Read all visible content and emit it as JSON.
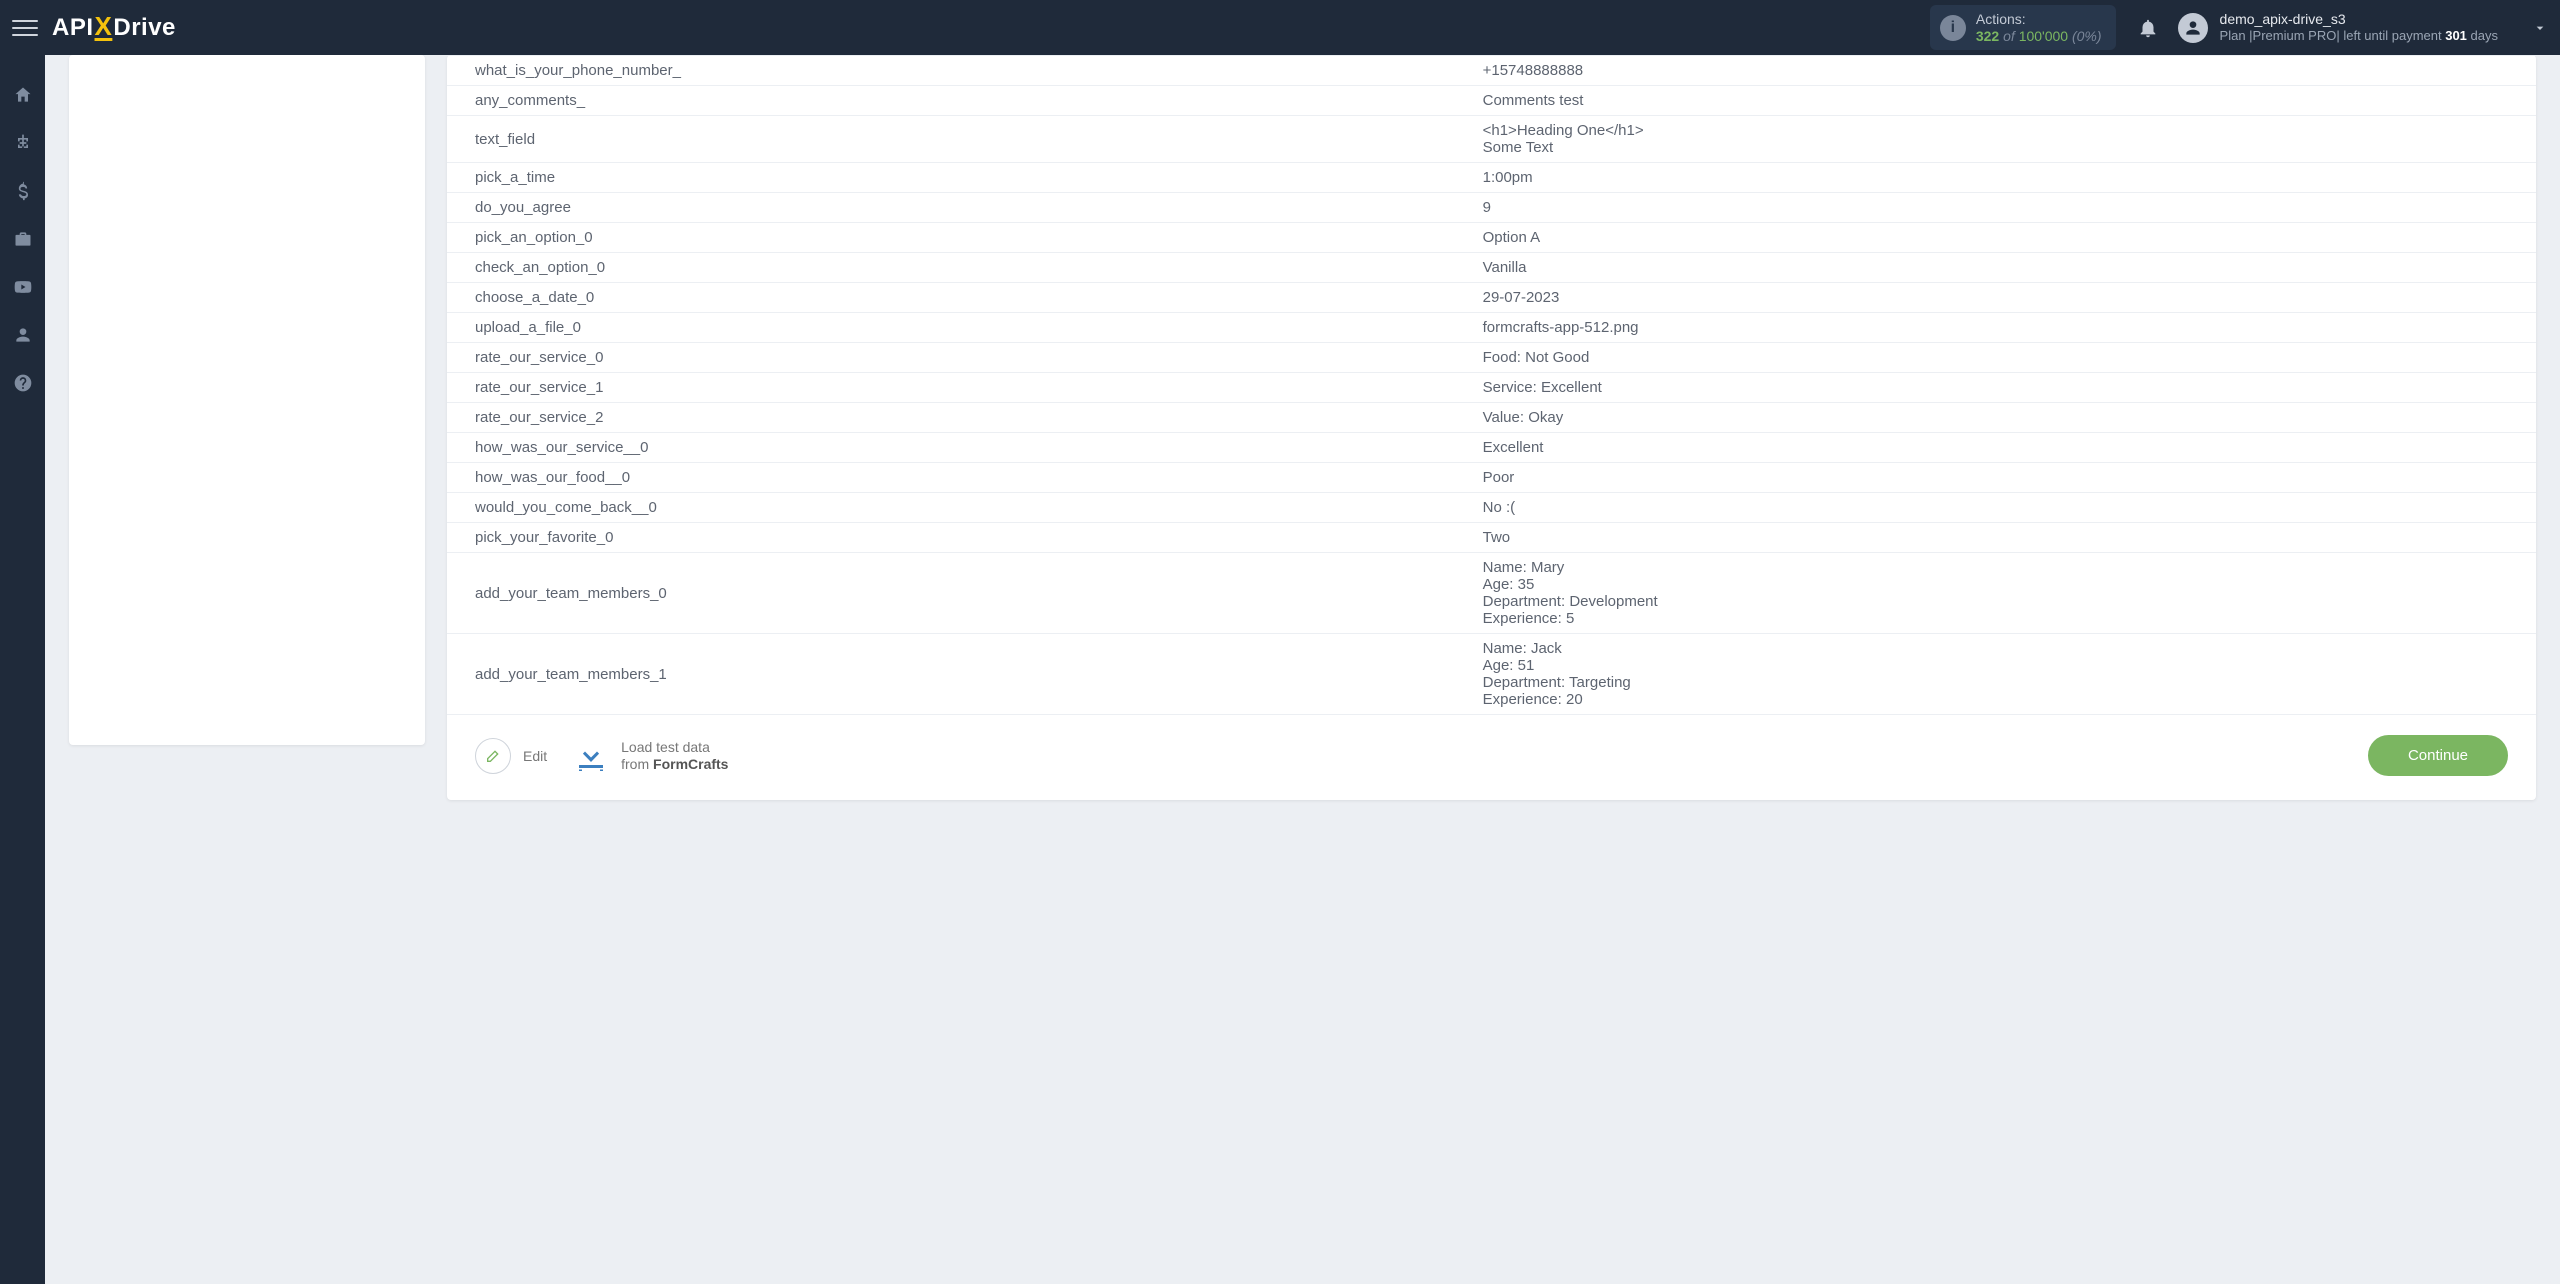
{
  "header": {
    "logo": {
      "part1": "API",
      "partX": "X",
      "part2": "Drive"
    },
    "actions_box": {
      "label": "Actions:",
      "used": "322",
      "of": "of",
      "limit": "100'000",
      "pct": "(0%)"
    },
    "user": {
      "name": "demo_apix-drive_s3",
      "plan_prefix": "Plan |",
      "plan_name": "Premium PRO",
      "plan_mid": "| left until payment ",
      "days_num": "301",
      "days_word": " days"
    }
  },
  "sidebar_icons": [
    "home",
    "sitemap",
    "dollar",
    "briefcase",
    "youtube",
    "user",
    "help"
  ],
  "rows": [
    {
      "k": "what_is_your_phone_number_",
      "v": "+15748888888"
    },
    {
      "k": "any_comments_",
      "v": "Comments test"
    },
    {
      "k": "text_field",
      "v": "<h1>Heading One</h1>\nSome Text"
    },
    {
      "k": "pick_a_time",
      "v": "1:00pm"
    },
    {
      "k": "do_you_agree",
      "v": "9"
    },
    {
      "k": "pick_an_option_0",
      "v": "Option A"
    },
    {
      "k": "check_an_option_0",
      "v": "Vanilla"
    },
    {
      "k": "choose_a_date_0",
      "v": "29-07-2023"
    },
    {
      "k": "upload_a_file_0",
      "v": "formcrafts-app-512.png"
    },
    {
      "k": "rate_our_service_0",
      "v": "Food: Not Good"
    },
    {
      "k": "rate_our_service_1",
      "v": "Service: Excellent"
    },
    {
      "k": "rate_our_service_2",
      "v": "Value: Okay"
    },
    {
      "k": "how_was_our_service__0",
      "v": "Excellent"
    },
    {
      "k": "how_was_our_food__0",
      "v": "Poor"
    },
    {
      "k": "would_you_come_back__0",
      "v": "No :("
    },
    {
      "k": "pick_your_favorite_0",
      "v": "Two"
    },
    {
      "k": "add_your_team_members_0",
      "v": "Name: Mary\nAge: 35\nDepartment: Development\nExperience: 5"
    },
    {
      "k": "add_your_team_members_1",
      "v": "Name: Jack\nAge: 51\nDepartment: Targeting\nExperience: 20"
    }
  ],
  "bottom": {
    "edit_label": "Edit",
    "load_line1": "Load test data",
    "load_from": "from ",
    "load_source": "FormCrafts",
    "continue_label": "Continue"
  }
}
